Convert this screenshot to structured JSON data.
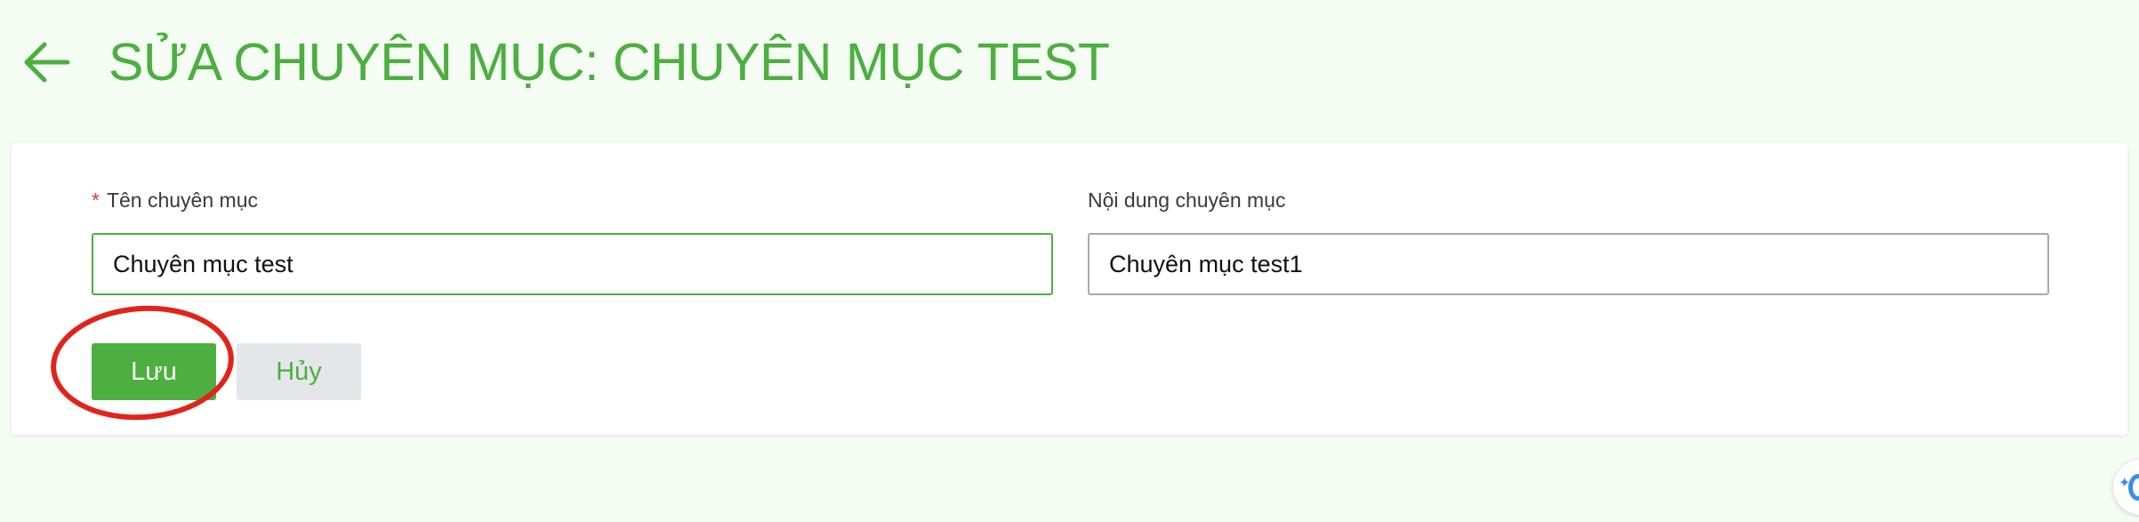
{
  "header": {
    "back_icon": "arrow-left-icon",
    "title": "SỬA CHUYÊN MỤC: CHUYÊN MỤC TEST"
  },
  "form": {
    "name_field": {
      "required_mark": "*",
      "label": "Tên chuyên mục",
      "value": "Chuyên mục test"
    },
    "content_field": {
      "label": "Nội dung chuyên mục",
      "value": "Chuyên mục test1"
    },
    "save_label": "Lưu",
    "cancel_label": "Hủy"
  },
  "colors": {
    "primary": "#4caf3f",
    "page_background": "#f4fcf4",
    "annotation": "#e2231a",
    "required": "#e53935"
  },
  "floating_widget": {
    "icon": "assistant-icon"
  }
}
